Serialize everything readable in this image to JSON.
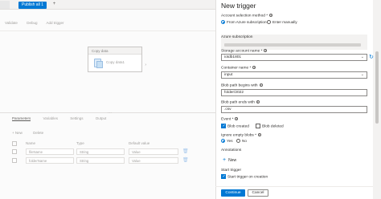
{
  "editor": {
    "publish_label": "Publish all",
    "publish_badge": "1",
    "add_tab": "+",
    "commands": [
      "Validate",
      "Debug",
      "Add trigger"
    ],
    "activity": {
      "type_label": "Copy data",
      "name": "Copy data1"
    },
    "bottom_tabs": [
      "Parameters",
      "Variables",
      "Settings",
      "Output"
    ],
    "param_actions": {
      "new": "+ New",
      "delete": "Delete"
    },
    "param_columns": [
      "Name",
      "Type",
      "Default value"
    ],
    "params": [
      {
        "name": "fileName",
        "type": "String",
        "default": "Value"
      },
      {
        "name": "folderName",
        "type": "String",
        "default": "Value"
      }
    ]
  },
  "panel": {
    "title": "New trigger",
    "account_selection_method": {
      "label": "Account selection method *",
      "options": [
        "From Azure subscription",
        "Enter manually"
      ],
      "selected": 0
    },
    "azure_subscription": {
      "label": "Azure subscription"
    },
    "storage_account": {
      "label": "Storage account name *",
      "value": "iotdb1801"
    },
    "container": {
      "label": "Container name *",
      "value": "input"
    },
    "blob_begins": {
      "label": "Blob path begins with",
      "value": "folder/2022"
    },
    "blob_ends": {
      "label": "Blob path ends with",
      "value": ".csv"
    },
    "event": {
      "label": "Event *",
      "options": [
        {
          "label": "Blob created",
          "checked": true
        },
        {
          "label": "Blob deleted",
          "checked": false
        }
      ]
    },
    "ignore_empty": {
      "label": "Ignore empty blobs *",
      "options": [
        "Yes",
        "No"
      ],
      "selected": 0
    },
    "annotations": {
      "label": "Annotations",
      "new_label": "New"
    },
    "start_trigger": {
      "label": "Start trigger",
      "checkbox_label": "Start trigger on creation",
      "checked": true
    },
    "buttons": {
      "continue": "Continue",
      "cancel": "Cancel"
    }
  },
  "colors": {
    "accent": "#0078d4"
  }
}
